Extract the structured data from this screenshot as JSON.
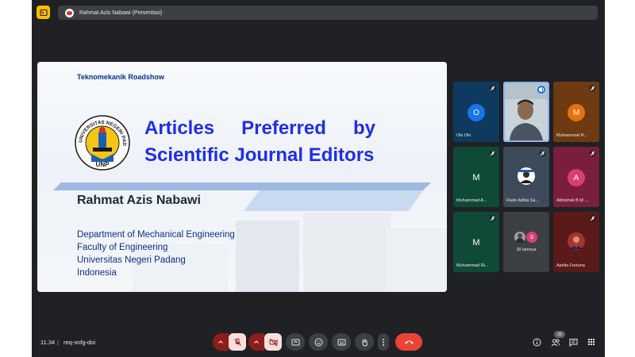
{
  "presentation_chip": {
    "title": "Rahmat Azis Nabawi (Presentasi)"
  },
  "slide": {
    "event": "Teknomekanik Roadshow",
    "title_line1_words": [
      "Articles",
      "Preferred",
      "by"
    ],
    "title_line2": "Scientific Journal Editors",
    "author": "Rahmat Azis Nabawi",
    "affiliation": [
      "Department of Mechanical Engineering",
      "Faculty of Engineering",
      "Universitas Negeri Padang",
      "Indonesia"
    ],
    "logo_text": "UNIVERSITAS NEGERI PADANG",
    "logo_sub": "UNP"
  },
  "participants": [
    {
      "name": "Oki Oki",
      "initial": "O",
      "bg": "#0d3a5e",
      "avatar_color": "#1a73e8",
      "muted": true
    },
    {
      "name": "",
      "initial": "",
      "bg": "#cfd8dc",
      "avatar_color": "",
      "muted": false,
      "speaking": true,
      "video": true
    },
    {
      "name": "Muhammad R...",
      "initial": "M",
      "bg": "#6e3a12",
      "avatar_color": "#e8710a",
      "muted": true
    },
    {
      "name": "Muhammad A...",
      "initial": "M",
      "bg": "#0f4a39",
      "avatar_color": "#0f4a39",
      "muted": true
    },
    {
      "name": "Rado Aditia Sa...",
      "initial": "",
      "bg": "#3d4a5a",
      "avatar_color": "#ffffff",
      "muted": true,
      "photo": true
    },
    {
      "name": "Abhishek B M ...",
      "initial": "A",
      "bg": "#7a1e3e",
      "avatar_color": "#d93d7a",
      "muted": true
    },
    {
      "name": "Muhammad Ri...",
      "initial": "M",
      "bg": "#0f4a39",
      "avatar_color": "#0f4a39",
      "muted": true
    },
    {
      "name": "30 lainnya",
      "initial": "S",
      "bg": "#3c4043",
      "avatar_color": "#d93d7a",
      "muted": false,
      "others": true
    },
    {
      "name": "Aprilia Fortuna",
      "initial": "",
      "bg": "#5a1a1a",
      "avatar_color": "#ffffff",
      "muted": true,
      "photo": true
    }
  ],
  "bottom": {
    "time": "11.34",
    "separator": "|",
    "meeting_code": "req-snfg-doi",
    "participant_count": "39"
  },
  "colors": {
    "background": "#202124",
    "accent_yellow": "#fbbc04",
    "end_call": "#ea4335",
    "muted_red": "#8c1d18",
    "slide_title": "#1f2ee6"
  },
  "icons": [
    "panel-icon",
    "chevron-up-icon",
    "mic-off-icon",
    "camera-off-icon",
    "present-icon",
    "emoji-icon",
    "captions-icon",
    "raise-hand-icon",
    "more-vert-icon",
    "call-end-icon",
    "info-icon",
    "people-icon",
    "chat-icon",
    "activities-icon"
  ]
}
